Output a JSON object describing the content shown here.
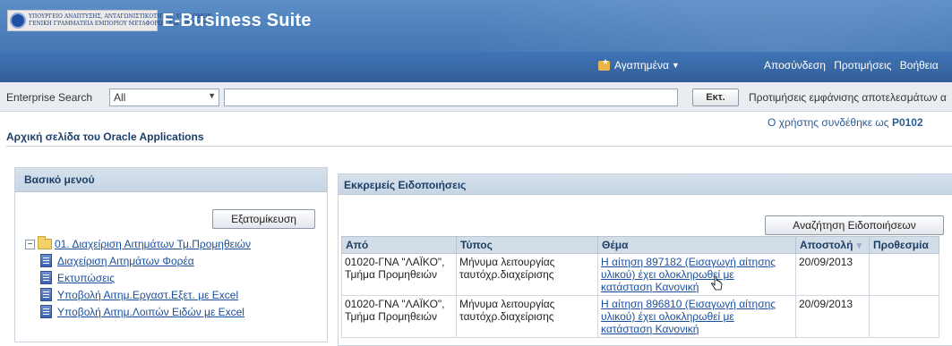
{
  "header": {
    "logo_line1": "ΥΠΟΥΡΓΕΙΟ ΑΝΑΠΤΥΞΗΣ, ΑΝΤΑΓΩΝΙΣΤΙΚΟΤΗΤΑΣ, ΥΠΟΔΟΜΩΝ,",
    "logo_line2": "ΓΕΝΙΚΗ ΓΡΑΜΜΑΤΕΙΑ ΕΜΠΟΡΙΟΥ   ΜΕΤΑΦΟΡΩΝ ΚΑΙ ΔΙΚΤΥΩΝ",
    "app_title": "E-Business Suite",
    "favorites_label": "Αγαπημένα",
    "logout": "Αποσύνδεση",
    "preferences": "Προτιμήσεις",
    "help": "Βοήθεια"
  },
  "search": {
    "label": "Enterprise Search",
    "select_value": "All",
    "input_value": "",
    "go_label": "Εκτ.",
    "prefs_text": "Προτιμήσεις εμφάνισης αποτελεσμάτων α"
  },
  "user": {
    "prefix": "Ο χρήστης συνδέθηκε ως",
    "name": "P0102"
  },
  "page_title": "Αρχική σελίδα του Oracle Applications",
  "main_menu": {
    "title": "Βασικό μενού",
    "personalize_label": "Εξατομίκευση",
    "root_label": "01. Διαχείριση Αιτημάτων Τμ.Προμηθειών",
    "items": [
      "Διαχείριση Αιτημάτων Φορέα",
      "Εκτυπώσεις",
      "Υποβολή Αιτημ.Εργαστ.Εξετ. με Excel",
      "Υποβολή Αιτημ.Λοιπών Ειδών με Excel"
    ]
  },
  "notifications": {
    "title": "Εκκρεμείς Ειδοποιήσεις",
    "search_button": "Αναζήτηση Ειδοποιήσεων",
    "columns": [
      "Από",
      "Τύπος",
      "Θέμα",
      "Αποστολή",
      "Προθεσμία"
    ],
    "rows": [
      {
        "from1": "01020-ΓΝΑ \"ΛΑΪΚΟ\",",
        "from2": "Τμήμα Προμηθειών",
        "type1": "Μήνυμα λειτουργίας",
        "type2": "ταυτόχρ.διαχείρισης",
        "subject1": "Η αίτηση 897182 (Εισαγωγή αίτησης",
        "subject2": "υλικού) έχει ολοκληρωθεί με",
        "subject3": "κατάσταση Κανονική",
        "sent": "20/09/2013",
        "due": ""
      },
      {
        "from1": "01020-ΓΝΑ \"ΛΑΪΚΟ\",",
        "from2": "Τμήμα Προμηθειών",
        "type1": "Μήνυμα λειτουργίας",
        "type2": "ταυτόχρ.διαχείρισης",
        "subject1": "Η αίτηση 896810 (Εισαγωγή αίτησης",
        "subject2": "υλικού) έχει ολοκληρωθεί με",
        "subject3": "κατάσταση Κανονική",
        "sent": "20/09/2013",
        "due": ""
      }
    ]
  }
}
